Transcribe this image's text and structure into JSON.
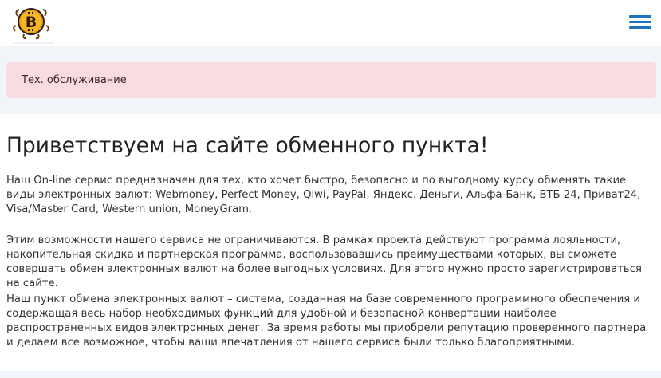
{
  "header": {
    "logo_icon": "bitcoin-logo-icon",
    "menu_icon": "hamburger-menu-icon",
    "menu_color": "#1e73be"
  },
  "alert": {
    "text": "Тех. обслуживание",
    "background": "#f8dde0"
  },
  "main": {
    "title": "Приветствуем на сайте обменного пункта!",
    "paragraphs": [
      "Наш On-line сервис предназначен для тех, кто хочет быстро, безопасно и по выгодному курсу обменять такие виды электронных валют: Webmoney, Perfect Money, Qiwi, PayPal, Яндекс. Деньги, Альфа-Банк, ВТБ 24, Приват24, Visa/Master Card, Western union, MoneyGram.",
      "Этим возможности нашего сервиса не ограничиваются. В рамках проекта действуют программа лояльности, накопительная скидка и партнерская программа, воспользовавшись преимуществами которых, вы сможете совершать обмен электронных валют на более выгодных условиях. Для этого нужно просто зарегистрироваться на сайте.",
      "Наш пункт обмена электронных валют – система, созданная на базе современного программного обеспечения и содержащая весь набор необходимых функций для удобной и безопасной конвертации наиболее распространенных видов электронных денег. За время работы мы приобрели репутацию проверенного партнера и делаем все возможное, чтобы ваши впечатления от нашего сервиса были только благоприятными."
    ]
  }
}
